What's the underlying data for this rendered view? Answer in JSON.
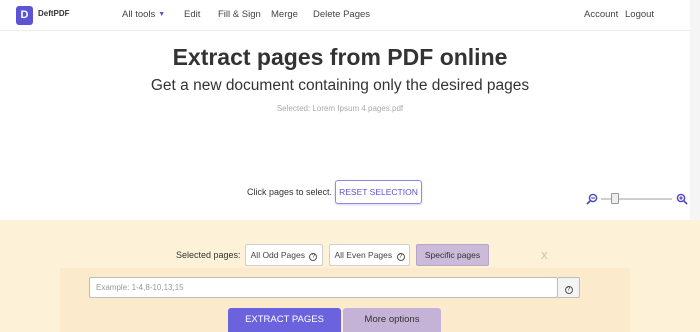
{
  "brand": {
    "logo_letter": "D",
    "name": "DeftPDF"
  },
  "nav": {
    "all_tools": "All tools",
    "edit": "Edit",
    "fill_sign": "Fill & Sign",
    "merge": "Merge",
    "delete_pages": "Delete Pages",
    "account": "Account",
    "logout": "Logout"
  },
  "header": {
    "title": "Extract pages from PDF online",
    "subtitle": "Get a new document containing only the desired pages",
    "selected_file": "Selected: Lorem Ipsum 4 pages.pdf"
  },
  "selection": {
    "instruction": "Click pages to select.",
    "reset_label": "RESET SELECTION"
  },
  "zoom": {
    "zoom_out_icon": "zoom-out-icon",
    "zoom_in_icon": "zoom-in-icon",
    "level": 0.2
  },
  "options": {
    "label": "Selected pages:",
    "odd_label": "All Odd Pages",
    "even_label": "All Even Pages",
    "specific_label": "Specific pages",
    "help_glyph": "?",
    "range_placeholder": "Example: 1-4,8-10,13,15",
    "range_value": "",
    "ghost_mark": "X"
  },
  "actions": {
    "extract_label": "EXTRACT PAGES",
    "more_label": "More options"
  },
  "colors": {
    "accent": "#5b55d6",
    "panel_bg": "#fdf2d8",
    "selected_option": "#cbbbd9"
  }
}
